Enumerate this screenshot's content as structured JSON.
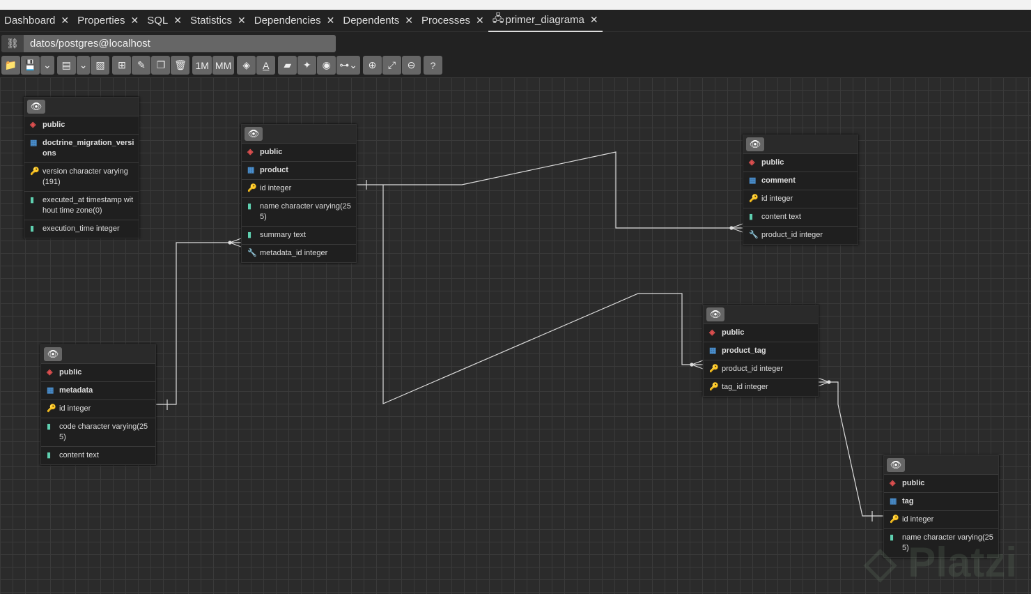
{
  "tabs": [
    {
      "label": "Dashboard"
    },
    {
      "label": "Properties"
    },
    {
      "label": "SQL"
    },
    {
      "label": "Statistics"
    },
    {
      "label": "Dependencies"
    },
    {
      "label": "Dependents"
    },
    {
      "label": "Processes"
    },
    {
      "label": "primer_diagrama",
      "active": true
    }
  ],
  "connection": "datos/postgres@localhost",
  "toolbar": {
    "one_to_many": "1M",
    "many_to_many": "MM"
  },
  "watermark": "Platzi",
  "tables": [
    {
      "schema": "public",
      "name": "doctrine_migration_versions",
      "columns": [
        {
          "text": "version character varying(191)",
          "icon": "key"
        },
        {
          "text": "executed_at timestamp without time zone(0)",
          "icon": "column"
        },
        {
          "text": "execution_time integer",
          "icon": "column"
        }
      ]
    },
    {
      "schema": "public",
      "name": "product",
      "columns": [
        {
          "text": "id integer",
          "icon": "key"
        },
        {
          "text": "name character varying(255)",
          "icon": "column"
        },
        {
          "text": "summary text",
          "icon": "column"
        },
        {
          "text": "metadata_id integer",
          "icon": "foreign-key"
        }
      ]
    },
    {
      "schema": "public",
      "name": "comment",
      "columns": [
        {
          "text": "id integer",
          "icon": "key"
        },
        {
          "text": "content text",
          "icon": "column"
        },
        {
          "text": "product_id integer",
          "icon": "foreign-key"
        }
      ]
    },
    {
      "schema": "public",
      "name": "product_tag",
      "columns": [
        {
          "text": "product_id integer",
          "icon": "key"
        },
        {
          "text": "tag_id integer",
          "icon": "key"
        }
      ]
    },
    {
      "schema": "public",
      "name": "metadata",
      "columns": [
        {
          "text": "id integer",
          "icon": "key"
        },
        {
          "text": "code character varying(255)",
          "icon": "column"
        },
        {
          "text": "content text",
          "icon": "column"
        }
      ]
    },
    {
      "schema": "public",
      "name": "tag",
      "columns": [
        {
          "text": "id integer",
          "icon": "key"
        },
        {
          "text": "name character varying(255)",
          "icon": "column"
        }
      ]
    }
  ]
}
